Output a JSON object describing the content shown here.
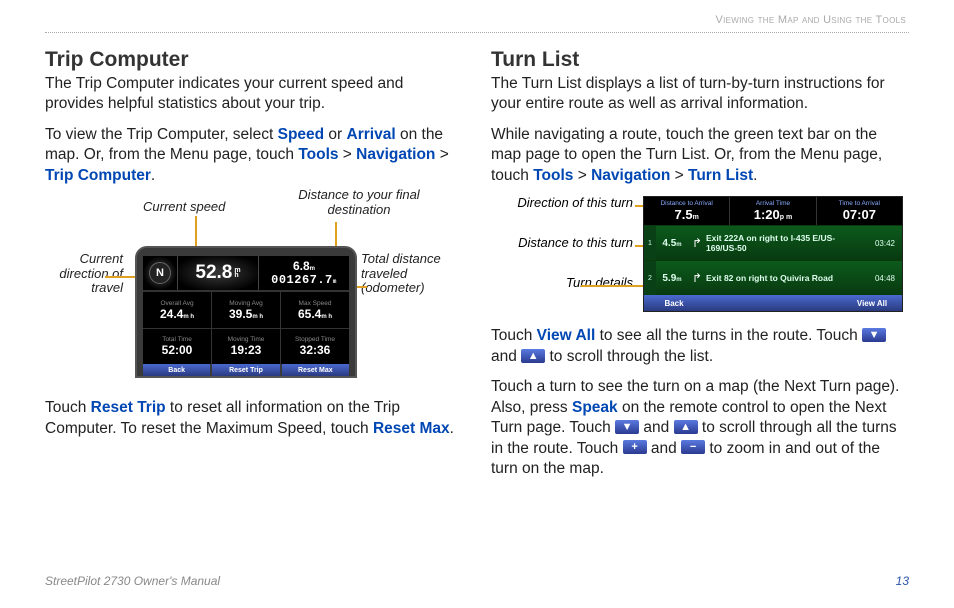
{
  "header": "Viewing the Map and Using the Tools",
  "footer": {
    "left": "StreetPilot 2730 Owner's Manual",
    "right": "13"
  },
  "left": {
    "heading": "Trip Computer",
    "p1": "The Trip Computer indicates your current speed and provides helpful statistics about your trip.",
    "p2a": "To view the Trip Computer, select ",
    "p2b": "Speed",
    "p2c": " or ",
    "p2d": "Arrival",
    "p2e": " on the map. Or, from the Menu page, touch ",
    "p2f": "Tools",
    "p2g": " > ",
    "p2h": "Navigation",
    "p2i": " > ",
    "p2j": "Trip Computer",
    "p2k": ".",
    "p3a": "Touch ",
    "p3b": "Reset Trip",
    "p3c": " to reset all information on the Trip Computer. To reset the Maximum Speed, touch ",
    "p3d": "Reset Max",
    "p3e": ".",
    "labels": {
      "currentSpeed": "Current speed",
      "distFinal": "Distance to your final destination",
      "direction": "Current direction of travel",
      "odometer": "Total distance traveled (odometer)"
    },
    "screen": {
      "compass": "N",
      "speed": "52.8",
      "speedUnitTop": "m",
      "speedUnitBot": "h",
      "distToDest": "6.8",
      "odometer": "001267.7",
      "btnBack": "Back",
      "btnResetTrip": "Reset Trip",
      "btnResetMax": "Reset Max",
      "stat1l": "Overall Avg",
      "stat1v": "24.4",
      "stat2l": "Moving Avg",
      "stat2v": "39.5",
      "stat3l": "Max Speed",
      "stat3v": "65.4",
      "stat4l": "Total Time",
      "stat4v": "52:00",
      "stat5l": "Moving Time",
      "stat5v": "19:23",
      "stat6l": "Stopped Time",
      "stat6v": "32:36"
    }
  },
  "right": {
    "heading": "Turn List",
    "p1": "The Turn List displays a list of turn-by-turn instructions for your entire route as well as arrival information.",
    "p2a": "While navigating a route, touch the green text bar on the map page to open the Turn List. Or, from the Menu page, touch ",
    "p2b": "Tools",
    "p2c": " > ",
    "p2d": "Navigation",
    "p2e": " > ",
    "p2f": "Turn List",
    "p2g": ".",
    "labels": {
      "dir": "Direction of this turn",
      "dist": "Distance to this turn",
      "details": "Turn details"
    },
    "screen": {
      "h1l": "Distance to Arrival",
      "h1v": "7.5",
      "h2l": "Arrival Time",
      "h2v": "1:20",
      "h3l": "Time to Arrival",
      "h3v": "07:07",
      "row1n": "1",
      "row1d": "4.5",
      "row1t": "Exit 222A on right to I-435 E/US-169/US-50",
      "row1time": "03:42",
      "row2n": "2",
      "row2d": "5.9",
      "row2t": "Exit 82 on right to Quivira Road",
      "row2time": "04:48",
      "btnBack": "Back",
      "btnViewAll": "View All"
    },
    "p3a": "Touch ",
    "p3b": "View All",
    "p3c": " to see all the turns in the route. Touch ",
    "p3d": " and ",
    "p3e": " to scroll through the list.",
    "p4a": "Touch a turn to see the turn on a map (the Next Turn page). Also, press ",
    "p4b": "Speak",
    "p4c": " on the remote control to open the Next Turn page. Touch ",
    "p4d": " and ",
    "p4e": " to scroll through all the turns in the route. Touch ",
    "p4f": " and ",
    "p4g": " to zoom in and out of the turn on the map."
  }
}
